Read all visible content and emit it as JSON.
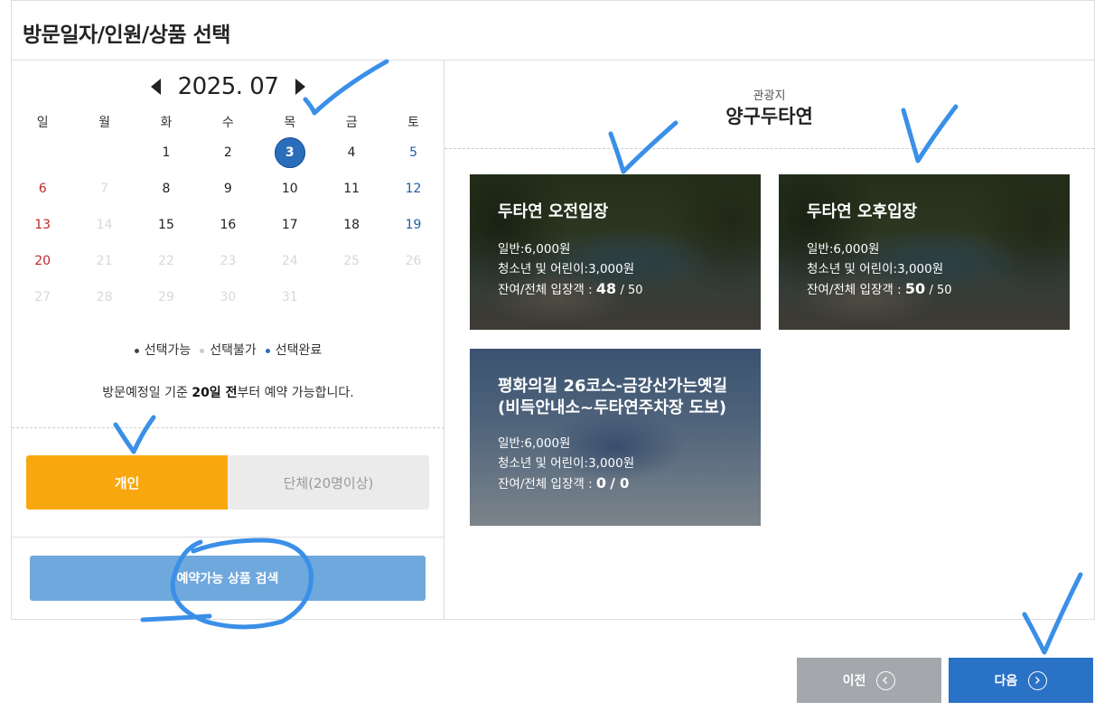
{
  "title": "방문일자/인원/상품 선택",
  "calendar": {
    "month_label": "2025. 07",
    "weekdays": [
      "일",
      "월",
      "화",
      "수",
      "목",
      "금",
      "토"
    ],
    "weeks": [
      [
        {
          "d": "",
          "s": ""
        },
        {
          "d": "",
          "s": ""
        },
        {
          "d": "1",
          "s": "n"
        },
        {
          "d": "2",
          "s": "n"
        },
        {
          "d": "3",
          "s": "sel"
        },
        {
          "d": "4",
          "s": "n"
        },
        {
          "d": "5",
          "s": "sat"
        }
      ],
      [
        {
          "d": "6",
          "s": "sun"
        },
        {
          "d": "7",
          "s": "dis"
        },
        {
          "d": "8",
          "s": "n"
        },
        {
          "d": "9",
          "s": "n"
        },
        {
          "d": "10",
          "s": "n"
        },
        {
          "d": "11",
          "s": "n"
        },
        {
          "d": "12",
          "s": "sat"
        }
      ],
      [
        {
          "d": "13",
          "s": "sun"
        },
        {
          "d": "14",
          "s": "dis"
        },
        {
          "d": "15",
          "s": "n"
        },
        {
          "d": "16",
          "s": "n"
        },
        {
          "d": "17",
          "s": "n"
        },
        {
          "d": "18",
          "s": "n"
        },
        {
          "d": "19",
          "s": "sat"
        }
      ],
      [
        {
          "d": "20",
          "s": "sun"
        },
        {
          "d": "21",
          "s": "dis"
        },
        {
          "d": "22",
          "s": "dis"
        },
        {
          "d": "23",
          "s": "dis"
        },
        {
          "d": "24",
          "s": "dis"
        },
        {
          "d": "25",
          "s": "dis"
        },
        {
          "d": "26",
          "s": "dis"
        }
      ],
      [
        {
          "d": "27",
          "s": "dis"
        },
        {
          "d": "28",
          "s": "dis"
        },
        {
          "d": "29",
          "s": "dis"
        },
        {
          "d": "30",
          "s": "dis"
        },
        {
          "d": "31",
          "s": "dis"
        },
        {
          "d": "",
          "s": ""
        },
        {
          "d": "",
          "s": ""
        }
      ]
    ]
  },
  "legend": [
    {
      "label": "선택가능",
      "color": "#444444"
    },
    {
      "label": "선택불가",
      "color": "#cccccc"
    },
    {
      "label": "선택완료",
      "color": "#2a6ebb"
    }
  ],
  "notice": {
    "before": "방문예정일 기준 ",
    "bold": "20일 전",
    "after": "부터 예약 가능합니다."
  },
  "visitor_type": {
    "individual": "개인",
    "group": "단체(20명이상)"
  },
  "search_button": "예약가능 상품 검색",
  "spot": {
    "category": "관광지",
    "name": "양구두타연"
  },
  "products": [
    {
      "name": "두타연 오전입장",
      "adult": "일반:6,000원",
      "youth": "청소년 및 어린이:3,000원",
      "cap_label": "잔여/전체 입장객 : ",
      "remaining": "48",
      "total": "/ 50"
    },
    {
      "name": "두타연 오후입장",
      "adult": "일반:6,000원",
      "youth": "청소년 및 어린이:3,000원",
      "cap_label": "잔여/전체 입장객 : ",
      "remaining": "50",
      "total": "/ 50"
    },
    {
      "name": "평화의길 26코스-금강산가는옛길 (비득안내소~두타연주차장 도보)",
      "adult": "일반:6,000원",
      "youth": "청소년 및 어린이:3,000원",
      "cap_label": "잔여/전체 입장객 : ",
      "remaining": "0",
      "total": "/ 0"
    }
  ],
  "buttons": {
    "prev": "이전",
    "next": "다음"
  }
}
